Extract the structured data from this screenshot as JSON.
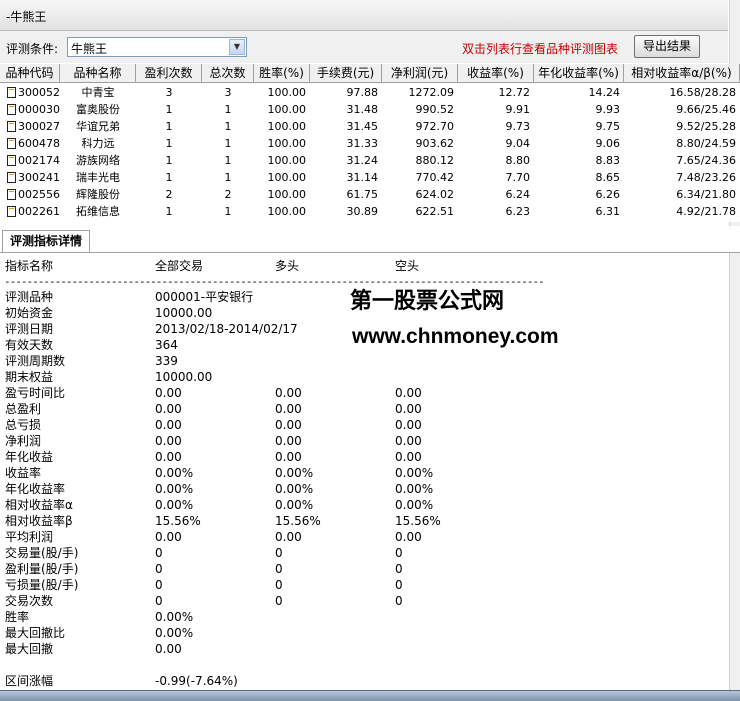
{
  "window": {
    "title": "-牛熊王"
  },
  "toolbar": {
    "condition_label": "评测条件:",
    "condition_value": "牛熊王",
    "hint": "双击列表行查看品种评测图表",
    "export_label": "导出结果"
  },
  "table": {
    "headers": [
      "品种代码",
      "品种名称",
      "盈利次数",
      "总次数",
      "胜率(%)",
      "手续费(元)",
      "净利润(元)",
      "收益率(%)",
      "年化收益率(%)",
      "相对收益率α/β(%)"
    ],
    "rows": [
      [
        "300052",
        "中青宝",
        "3",
        "3",
        "100.00",
        "97.88",
        "1272.09",
        "12.72",
        "14.24",
        "16.58/28.28"
      ],
      [
        "000030",
        "富奥股份",
        "1",
        "1",
        "100.00",
        "31.48",
        "990.52",
        "9.91",
        "9.93",
        "9.66/25.46"
      ],
      [
        "300027",
        "华谊兄弟",
        "1",
        "1",
        "100.00",
        "31.45",
        "972.70",
        "9.73",
        "9.75",
        "9.52/25.28"
      ],
      [
        "600478",
        "科力远",
        "1",
        "1",
        "100.00",
        "31.33",
        "903.62",
        "9.04",
        "9.06",
        "8.80/24.59"
      ],
      [
        "002174",
        "游族网络",
        "1",
        "1",
        "100.00",
        "31.24",
        "880.12",
        "8.80",
        "8.83",
        "7.65/24.36"
      ],
      [
        "300241",
        "瑞丰光电",
        "1",
        "1",
        "100.00",
        "31.14",
        "770.42",
        "7.70",
        "8.65",
        "7.48/23.26"
      ],
      [
        "002556",
        "辉隆股份",
        "2",
        "2",
        "100.00",
        "61.75",
        "624.02",
        "6.24",
        "6.26",
        "6.34/21.80"
      ],
      [
        "002261",
        "拓维信息",
        "1",
        "1",
        "100.00",
        "30.89",
        "622.51",
        "6.23",
        "6.31",
        "4.92/21.78"
      ]
    ]
  },
  "tab": {
    "label": "评测指标详情"
  },
  "details": {
    "headers": [
      "指标名称",
      "全部交易",
      "多头",
      "空头"
    ],
    "separator": "------------------------------------------------------------------------------------------------",
    "rows": [
      [
        "评测品种",
        "000001-平安银行",
        "",
        ""
      ],
      [
        "初始资金",
        "10000.00",
        "",
        ""
      ],
      [
        "评测日期",
        "2013/02/18-2014/02/17",
        "",
        ""
      ],
      [
        "有效天数",
        "364",
        "",
        ""
      ],
      [
        "评测周期数",
        "339",
        "",
        ""
      ],
      [
        "期末权益",
        "10000.00",
        "",
        ""
      ],
      [
        "盈亏时间比",
        "0.00",
        "0.00",
        "0.00"
      ],
      [
        "总盈利",
        "0.00",
        "0.00",
        "0.00"
      ],
      [
        "总亏损",
        "0.00",
        "0.00",
        "0.00"
      ],
      [
        "净利润",
        "0.00",
        "0.00",
        "0.00"
      ],
      [
        "年化收益",
        "0.00",
        "0.00",
        "0.00"
      ],
      [
        "收益率",
        "0.00%",
        "0.00%",
        "0.00%"
      ],
      [
        "年化收益率",
        "0.00%",
        "0.00%",
        "0.00%"
      ],
      [
        "相对收益率α",
        "0.00%",
        "0.00%",
        "0.00%"
      ],
      [
        "相对收益率β",
        "15.56%",
        "15.56%",
        "15.56%"
      ],
      [
        "平均利润",
        "0.00",
        "0.00",
        "0.00"
      ],
      [
        "交易量(股/手)",
        "0",
        "0",
        "0"
      ],
      [
        "盈利量(股/手)",
        "0",
        "0",
        "0"
      ],
      [
        "亏损量(股/手)",
        "0",
        "0",
        "0"
      ],
      [
        "交易次数",
        "0",
        "0",
        "0"
      ],
      [
        "胜率",
        "0.00%",
        "",
        ""
      ],
      [
        "最大回撤比",
        "0.00%",
        "",
        ""
      ],
      [
        "最大回撤",
        "0.00",
        "",
        ""
      ],
      [
        "",
        "",
        " ",
        ""
      ],
      [
        "区间涨幅",
        "-0.99(-7.64%)",
        "",
        ""
      ]
    ]
  },
  "watermark": {
    "line1": "第一股票公式网",
    "line2": "www.chnmoney.com"
  }
}
